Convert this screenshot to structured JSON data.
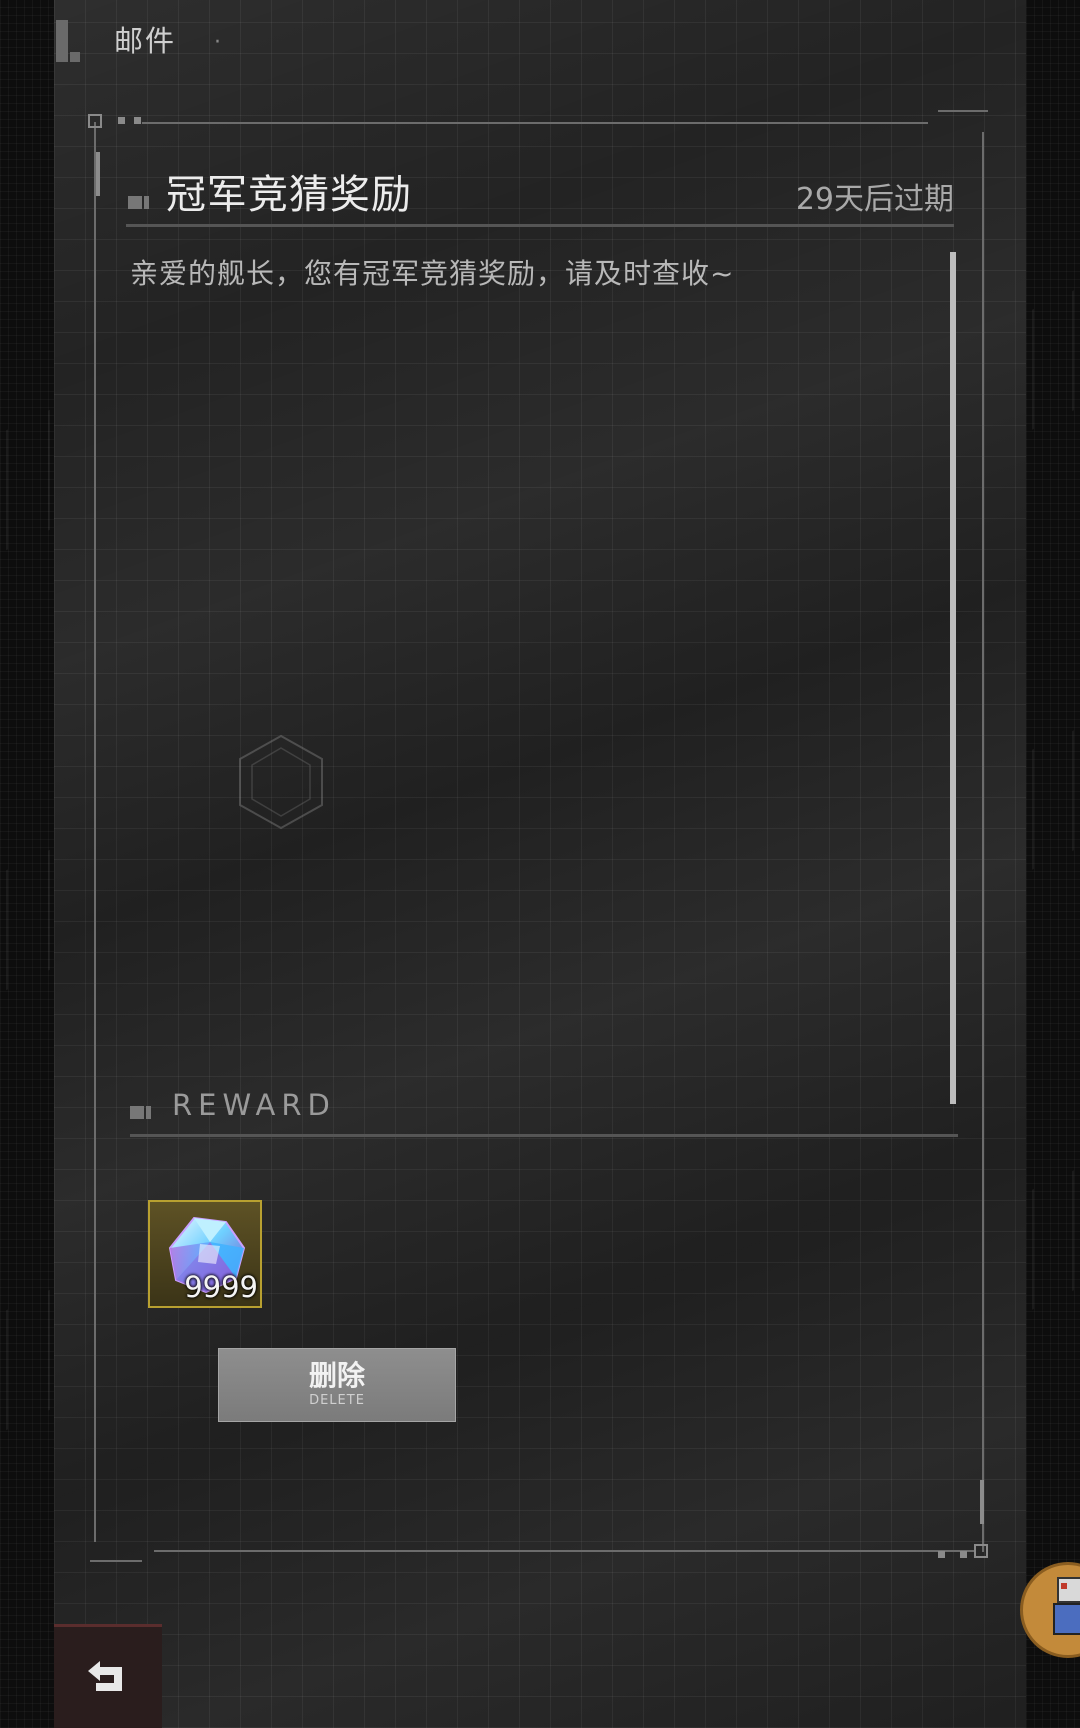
{
  "header": {
    "title": "邮件"
  },
  "mail": {
    "subject": "冠军竞猜奖励",
    "expiry": "29天后过期",
    "body": "亲爱的舰长，您有冠军竞猜奖励，请及时查收~"
  },
  "reward": {
    "section_label": "REWARD",
    "items": [
      {
        "icon": "crystal-icon",
        "count": "9999"
      }
    ]
  },
  "actions": {
    "delete_label": "删除",
    "delete_sublabel": "DELETE"
  },
  "colors": {
    "panel_bg": "#232323",
    "reward_frame": "#b8a030",
    "button_bg": "#8a8a8a"
  }
}
